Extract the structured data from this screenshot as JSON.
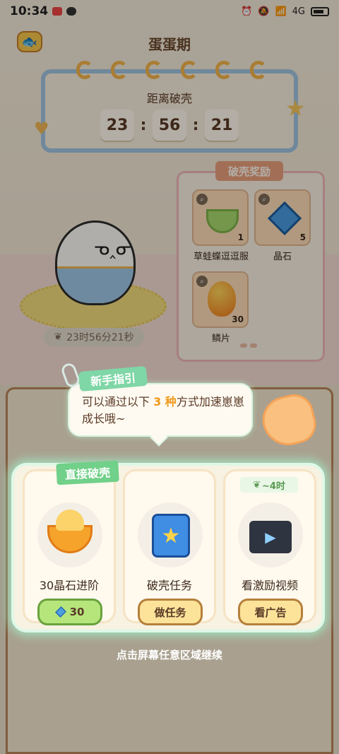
{
  "status_bar": {
    "time": "10:34",
    "network": "4G"
  },
  "header": {
    "title": "蛋蛋期",
    "back_icon": "fish-back-icon"
  },
  "countdown": {
    "label": "距离破壳",
    "hours": "23",
    "minutes": "56",
    "seconds": "21",
    "separator": ":"
  },
  "egg": {
    "timer_text": "23时56分21秒"
  },
  "rewards": {
    "title": "破壳奖励",
    "items": [
      {
        "name": "草蛙蝶逗逗服",
        "count": "1"
      },
      {
        "name": "晶石",
        "count": "5"
      },
      {
        "name": "鳞片",
        "count": "30"
      }
    ]
  },
  "guide": {
    "tag": "新手指引",
    "text_before": "可以通过以下 ",
    "highlight": "3 种",
    "text_after": "方式加速崽崽成长哦~"
  },
  "options": [
    {
      "tag": "直接破壳",
      "name": "30晶石进阶",
      "button": "30"
    },
    {
      "name": "破壳任务",
      "button": "做任务"
    },
    {
      "tag": "~4时",
      "name": "看激励视频",
      "button": "看广告"
    }
  ],
  "hint": "点击屏幕任意区域继续",
  "colors": {
    "accent_green": "#71d089",
    "accent_orange": "#f19a1d",
    "board_blue": "#9fc3e0"
  }
}
